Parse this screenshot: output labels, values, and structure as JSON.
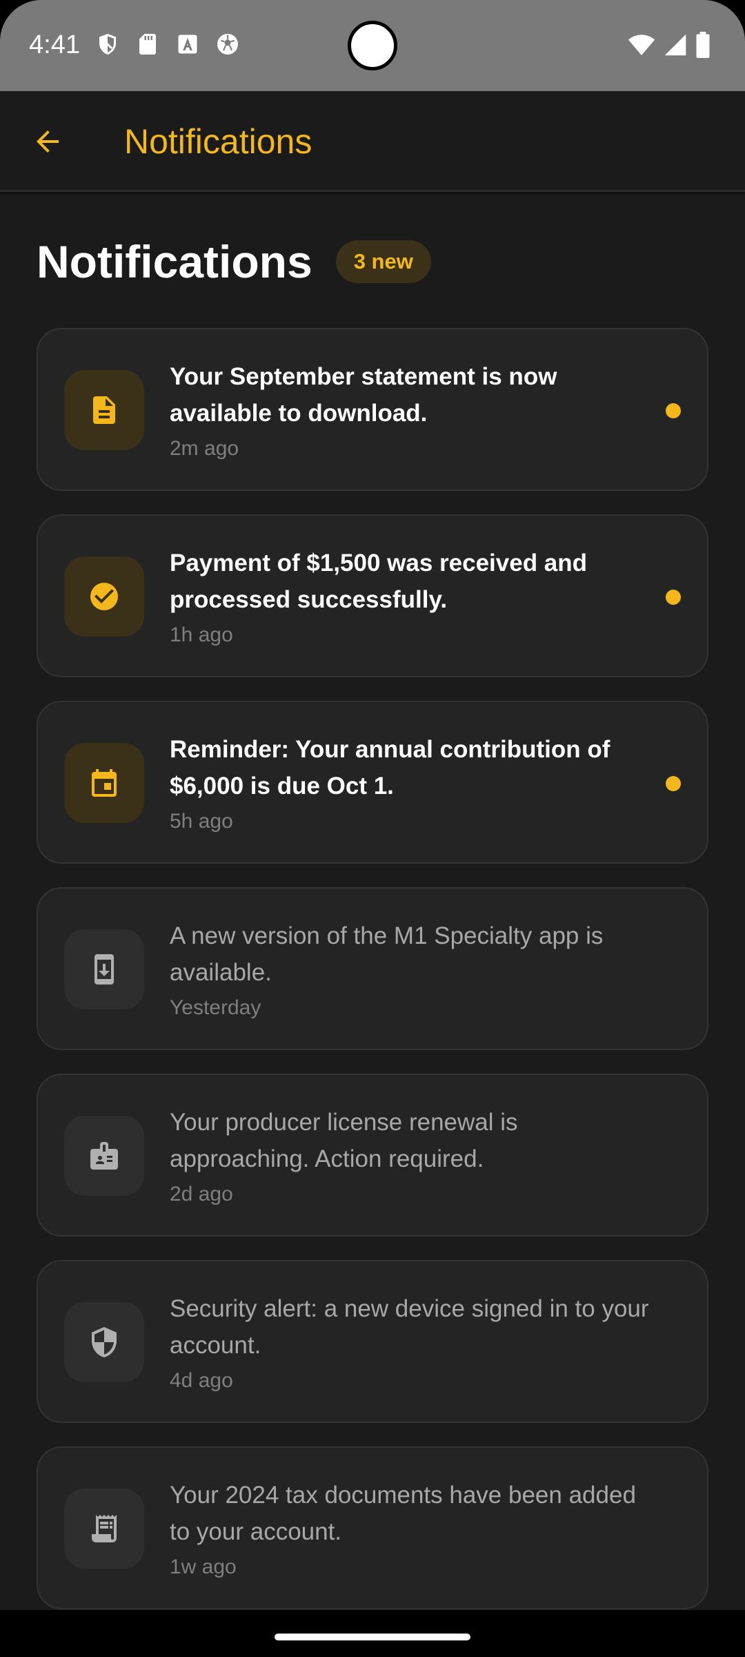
{
  "status_bar": {
    "time": "4:41",
    "left_icons": [
      "shield-icon",
      "sd-card-icon",
      "font-a-icon",
      "soccer-ball-icon"
    ],
    "right_icons": [
      "wifi-icon",
      "signal-icon",
      "battery-icon"
    ]
  },
  "app_bar": {
    "title": "Notifications",
    "back_icon": "arrow-back-icon"
  },
  "page": {
    "title": "Notifications",
    "new_badge": "3 new"
  },
  "notifications": [
    {
      "message": "Your September statement is now available to download.",
      "time": "2m ago",
      "unread": true,
      "icon": "document-icon"
    },
    {
      "message": "Payment of $1,500 was received and processed successfully.",
      "time": "1h ago",
      "unread": true,
      "icon": "check-circle-icon"
    },
    {
      "message": "Reminder: Your annual contribution of $6,000 is due Oct 1.",
      "time": "5h ago",
      "unread": true,
      "icon": "calendar-icon"
    },
    {
      "message": "A new version of the M1 Specialty app is available.",
      "time": "Yesterday",
      "unread": false,
      "icon": "system-update-icon"
    },
    {
      "message": "Your producer license renewal is approaching. Action required.",
      "time": "2d ago",
      "unread": false,
      "icon": "badge-icon"
    },
    {
      "message": "Security alert: a new device signed in to your account.",
      "time": "4d ago",
      "unread": false,
      "icon": "security-shield-icon"
    },
    {
      "message": "Your 2024 tax documents have been added to your account.",
      "time": "1w ago",
      "unread": false,
      "icon": "receipt-icon"
    }
  ],
  "colors": {
    "accent": "#f5b81c",
    "background": "#1b1b1b",
    "card": "#242424",
    "status_bar": "#7a7a7a"
  }
}
